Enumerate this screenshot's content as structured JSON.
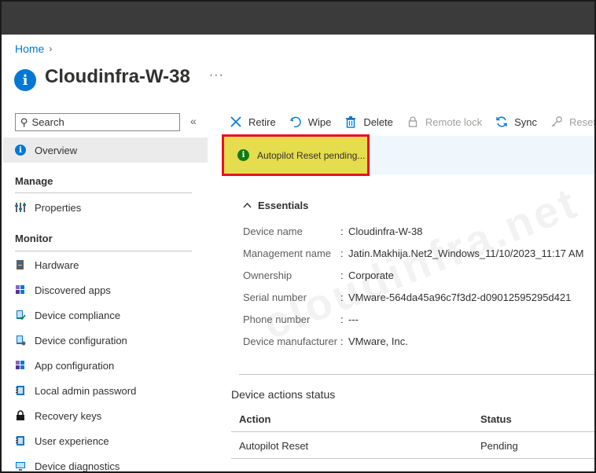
{
  "breadcrumb": {
    "home": "Home"
  },
  "page": {
    "title": "Cloudinfra-W-38",
    "more": "···"
  },
  "sidebar": {
    "search_placeholder": "Search",
    "collapse": "«",
    "overview": "Overview",
    "manage_label": "Manage",
    "properties": "Properties",
    "monitor_label": "Monitor",
    "items": [
      {
        "label": "Hardware",
        "icon": "hardware-icon"
      },
      {
        "label": "Discovered apps",
        "icon": "apps-icon"
      },
      {
        "label": "Device compliance",
        "icon": "compliance-icon"
      },
      {
        "label": "Device configuration",
        "icon": "configuration-icon"
      },
      {
        "label": "App configuration",
        "icon": "app-config-icon"
      },
      {
        "label": "Local admin password",
        "icon": "notebook-icon"
      },
      {
        "label": "Recovery keys",
        "icon": "lock-icon"
      },
      {
        "label": "User experience",
        "icon": "notebook-icon"
      },
      {
        "label": "Device diagnostics",
        "icon": "monitor-icon"
      }
    ]
  },
  "toolbar": {
    "retire": "Retire",
    "wipe": "Wipe",
    "delete": "Delete",
    "remote_lock": "Remote lock",
    "sync": "Sync",
    "reset_passcode": "Reset pa"
  },
  "banner": {
    "text": "Autopilot Reset pending..."
  },
  "watermark": "cloudinfra.net",
  "essentials": {
    "title": "Essentials",
    "rows": [
      {
        "label": "Device name",
        "value": "Cloudinfra-W-38"
      },
      {
        "label": "Management name",
        "value": "Jatin.Makhija.Net2_Windows_11/10/2023_11:17 AM"
      },
      {
        "label": "Ownership",
        "value": "Corporate"
      },
      {
        "label": "Serial number",
        "value": "VMware-564da45a96c7f3d2-d09012595295d421"
      },
      {
        "label": "Phone number",
        "value": "---"
      },
      {
        "label": "Device manufacturer",
        "value": "VMware, Inc."
      }
    ]
  },
  "device_actions": {
    "title": "Device actions status",
    "columns": [
      "Action",
      "Status"
    ],
    "rows": [
      {
        "action": "Autopilot Reset",
        "status": "Pending"
      }
    ]
  },
  "colors": {
    "accent": "#0078d4",
    "banner_highlight": "#e5dc4e",
    "highlight_border": "#e81123",
    "info_green": "#107c10",
    "topbar": "#3b3b3b"
  }
}
